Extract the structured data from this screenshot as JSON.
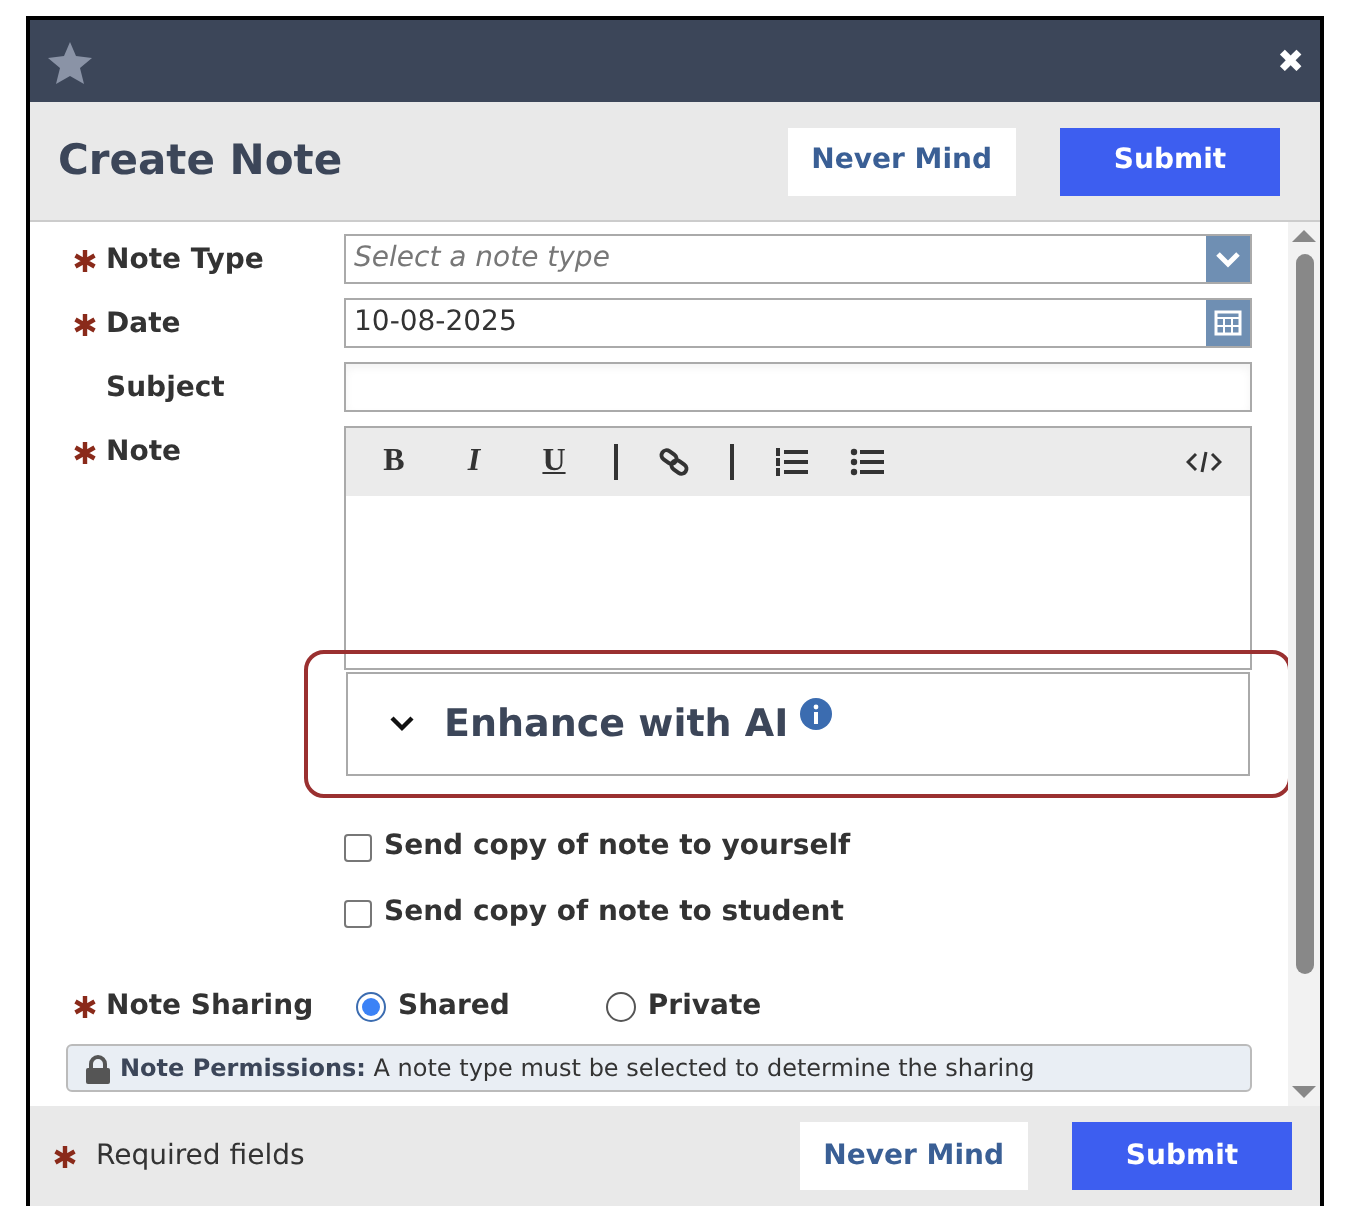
{
  "window": {
    "close": "✖"
  },
  "header": {
    "title": "Create Note",
    "buttons": [
      {
        "label": "Never Mind",
        "kind": "secondary"
      },
      {
        "label": "Submit",
        "kind": "primary"
      }
    ]
  },
  "fields": [
    {
      "label": "Note Type",
      "required": true,
      "kind": "select",
      "placeholder": "Select a note type"
    },
    {
      "label": "Date",
      "required": true,
      "kind": "date",
      "value": "10-08-2025"
    },
    {
      "label": "Subject",
      "required": false,
      "kind": "text"
    },
    {
      "label": "Note",
      "required": true,
      "kind": "editor"
    }
  ],
  "editor_toolbar": [
    {
      "kind": "bold",
      "label": "B"
    },
    {
      "kind": "italic",
      "label": "I"
    },
    {
      "kind": "underline",
      "label": "U"
    },
    {
      "kind": "divider"
    },
    {
      "kind": "link"
    },
    {
      "kind": "divider"
    },
    {
      "kind": "ordered"
    },
    {
      "kind": "bullets"
    },
    {
      "kind": "code"
    }
  ],
  "enhance": {
    "label": "Enhance with AI",
    "expanded": false,
    "highlighted": true
  },
  "checkboxes": [
    {
      "label": "Send copy of note to yourself",
      "checked": false
    },
    {
      "label": "Send copy of note to student",
      "checked": false
    }
  ],
  "sharing": {
    "label": "Note Sharing",
    "required": true,
    "options": [
      {
        "label": "Shared",
        "selected": true
      },
      {
        "label": "Private",
        "selected": false
      }
    ]
  },
  "permissions": {
    "text": "**Note Permissions:** A note type must be selected to determine the sharing"
  },
  "footer": {
    "required_text": "Required fields",
    "buttons": [
      {
        "label": "Never Mind",
        "kind": "secondary"
      },
      {
        "label": "Submit",
        "kind": "primary"
      }
    ]
  }
}
